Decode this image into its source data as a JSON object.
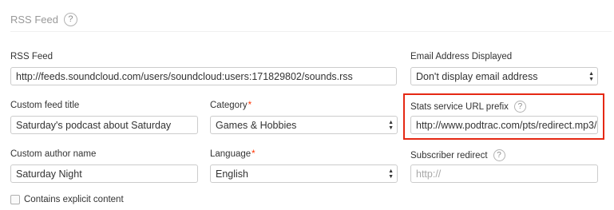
{
  "section": {
    "title": "RSS Feed",
    "help": "?"
  },
  "rss_feed": {
    "label": "RSS Feed",
    "value": "http://feeds.soundcloud.com/users/soundcloud:users:171829802/sounds.rss"
  },
  "email": {
    "label": "Email Address Displayed",
    "value": "Don't display email address"
  },
  "custom_title": {
    "label": "Custom feed title",
    "value": "Saturday's podcast about Saturday"
  },
  "category": {
    "label": "Category",
    "required": "*",
    "value": "Games & Hobbies"
  },
  "stats": {
    "label": "Stats service URL prefix",
    "help": "?",
    "value": "http://www.podtrac.com/pts/redirect.mp3/"
  },
  "author": {
    "label": "Custom author name",
    "value": "Saturday Night"
  },
  "language": {
    "label": "Language",
    "required": "*",
    "value": "English"
  },
  "subscriber": {
    "label": "Subscriber redirect",
    "help": "?",
    "placeholder": "http://"
  },
  "explicit": {
    "label": "Contains explicit content",
    "checked": false
  },
  "highlight_color": "#e52814"
}
